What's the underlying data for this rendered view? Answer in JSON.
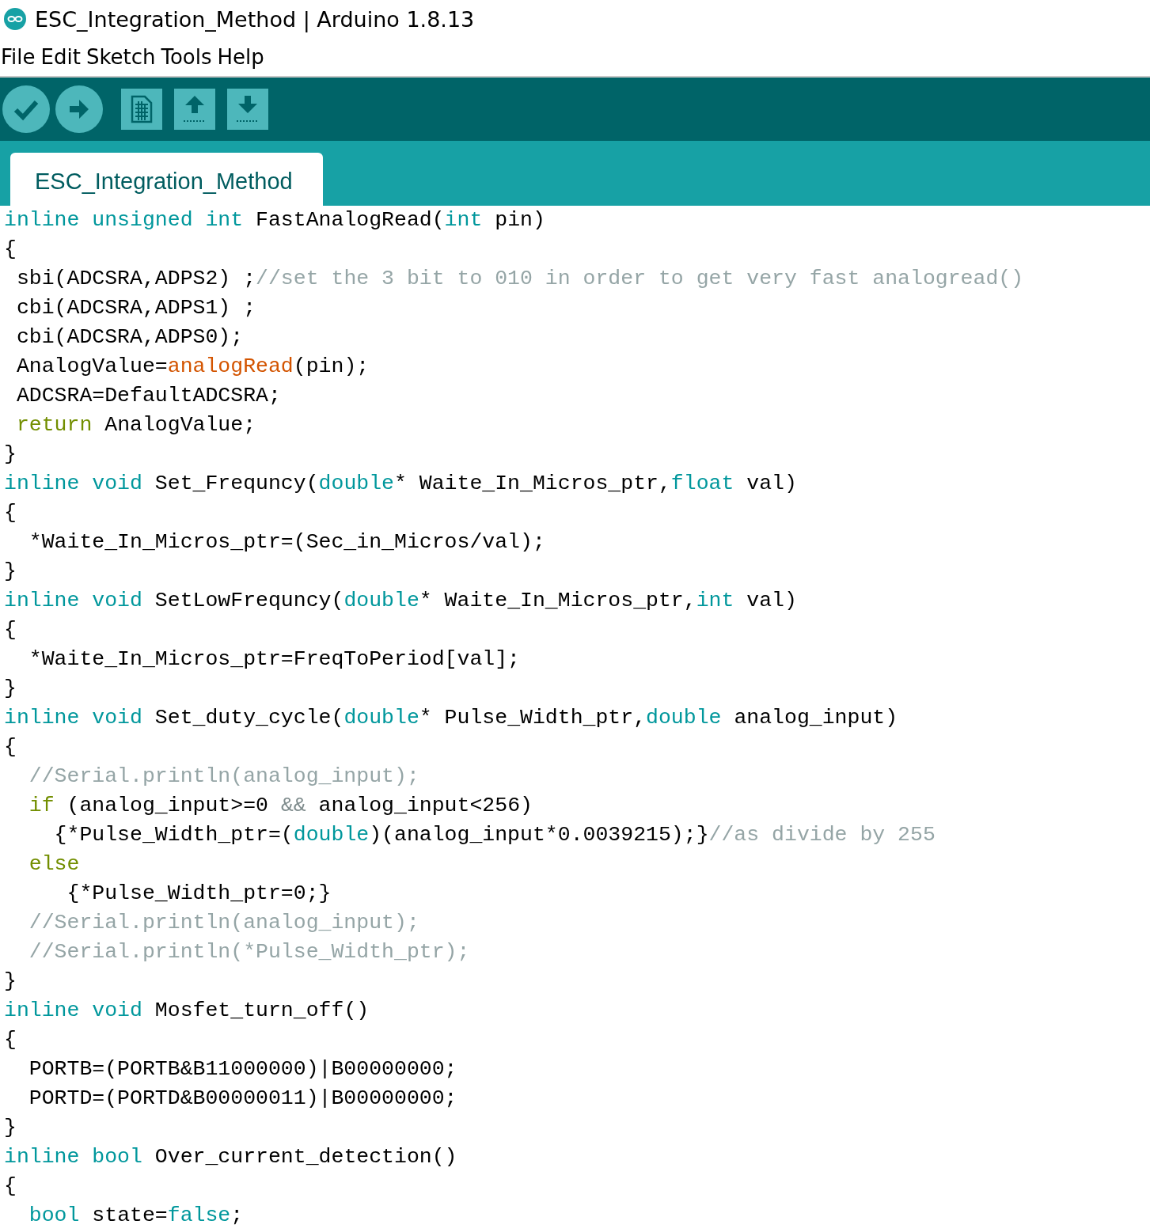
{
  "window": {
    "title": "ESC_Integration_Method | Arduino 1.8.13"
  },
  "menu": [
    "File",
    "Edit",
    "Sketch",
    "Tools",
    "Help"
  ],
  "tabs": [
    {
      "label": "ESC_Integration_Method",
      "selected": true
    }
  ],
  "code": [
    [
      {
        "kind": "type",
        "text": "inline unsigned int"
      },
      {
        "kind": "plain",
        "text": " FastAnalogRead("
      },
      {
        "kind": "type",
        "text": "int"
      },
      {
        "kind": "plain",
        "text": " pin)"
      }
    ],
    [
      {
        "kind": "plain",
        "text": "{"
      }
    ],
    [
      {
        "kind": "plain",
        "text": " sbi(ADCSRA,ADPS2) ;"
      },
      {
        "kind": "comment",
        "text": "//set the 3 bit to 010 in order to get very fast analogread()"
      }
    ],
    [
      {
        "kind": "plain",
        "text": " cbi(ADCSRA,ADPS1) ;"
      }
    ],
    [
      {
        "kind": "plain",
        "text": " cbi(ADCSRA,ADPS0);"
      }
    ],
    [
      {
        "kind": "plain",
        "text": " AnalogValue="
      },
      {
        "kind": "function",
        "text": "analogRead"
      },
      {
        "kind": "plain",
        "text": "(pin);"
      }
    ],
    [
      {
        "kind": "plain",
        "text": " ADCSRA=DefaultADCSRA;"
      }
    ],
    [
      {
        "kind": "keyword",
        "text": " return"
      },
      {
        "kind": "plain",
        "text": " AnalogValue;"
      }
    ],
    [
      {
        "kind": "plain",
        "text": "}"
      }
    ],
    [
      {
        "kind": "type",
        "text": "inline void"
      },
      {
        "kind": "plain",
        "text": " Set_Frequncy("
      },
      {
        "kind": "type",
        "text": "double"
      },
      {
        "kind": "plain",
        "text": "* Waite_In_Micros_ptr,"
      },
      {
        "kind": "type",
        "text": "float"
      },
      {
        "kind": "plain",
        "text": " val)"
      }
    ],
    [
      {
        "kind": "plain",
        "text": "{"
      }
    ],
    [
      {
        "kind": "plain",
        "text": "  *Waite_In_Micros_ptr=(Sec_in_Micros/val);"
      }
    ],
    [
      {
        "kind": "plain",
        "text": "}"
      }
    ],
    [
      {
        "kind": "type",
        "text": "inline void"
      },
      {
        "kind": "plain",
        "text": " SetLowFrequncy("
      },
      {
        "kind": "type",
        "text": "double"
      },
      {
        "kind": "plain",
        "text": "* Waite_In_Micros_ptr,"
      },
      {
        "kind": "type",
        "text": "int"
      },
      {
        "kind": "plain",
        "text": " val)"
      }
    ],
    [
      {
        "kind": "plain",
        "text": "{"
      }
    ],
    [
      {
        "kind": "plain",
        "text": "  *Waite_In_Micros_ptr=FreqToPeriod[val];"
      }
    ],
    [
      {
        "kind": "plain",
        "text": "}"
      }
    ],
    [
      {
        "kind": "type",
        "text": "inline void"
      },
      {
        "kind": "plain",
        "text": " Set_duty_cycle("
      },
      {
        "kind": "type",
        "text": "double"
      },
      {
        "kind": "plain",
        "text": "* Pulse_Width_ptr,"
      },
      {
        "kind": "type",
        "text": "double"
      },
      {
        "kind": "plain",
        "text": " analog_input)"
      }
    ],
    [
      {
        "kind": "plain",
        "text": "{"
      }
    ],
    [
      {
        "kind": "comment",
        "text": "  //Serial.println(analog_input);"
      }
    ],
    [
      {
        "kind": "keyword",
        "text": "  if"
      },
      {
        "kind": "plain",
        "text": " (analog_input>=0 "
      },
      {
        "kind": "operator",
        "text": "&&"
      },
      {
        "kind": "plain",
        "text": " analog_input<256)"
      }
    ],
    [
      {
        "kind": "plain",
        "text": "    {*Pulse_Width_ptr=("
      },
      {
        "kind": "type",
        "text": "double"
      },
      {
        "kind": "plain",
        "text": ")(analog_input*0.0039215);}"
      },
      {
        "kind": "comment",
        "text": "//as divide by 255"
      }
    ],
    [
      {
        "kind": "keyword",
        "text": "  else"
      }
    ],
    [
      {
        "kind": "plain",
        "text": "     {*Pulse_Width_ptr=0;}"
      }
    ],
    [
      {
        "kind": "comment",
        "text": "  //Serial.println(analog_input);"
      }
    ],
    [
      {
        "kind": "comment",
        "text": "  //Serial.println(*Pulse_Width_ptr);"
      }
    ],
    [
      {
        "kind": "plain",
        "text": "}"
      }
    ],
    [
      {
        "kind": "type",
        "text": "inline void"
      },
      {
        "kind": "plain",
        "text": " Mosfet_turn_off()"
      }
    ],
    [
      {
        "kind": "plain",
        "text": "{"
      }
    ],
    [
      {
        "kind": "plain",
        "text": "  PORTB=(PORTB&B11000000)|B00000000;"
      }
    ],
    [
      {
        "kind": "plain",
        "text": "  PORTD=(PORTD&B00000011)|B00000000;"
      }
    ],
    [
      {
        "kind": "plain",
        "text": "}"
      }
    ],
    [
      {
        "kind": "type",
        "text": "inline bool"
      },
      {
        "kind": "plain",
        "text": " Over_current_detection()"
      }
    ],
    [
      {
        "kind": "plain",
        "text": "{"
      }
    ],
    [
      {
        "kind": "type",
        "text": "  bool"
      },
      {
        "kind": "plain",
        "text": " state="
      },
      {
        "kind": "type",
        "text": "false"
      },
      {
        "kind": "plain",
        "text": ";"
      }
    ]
  ]
}
